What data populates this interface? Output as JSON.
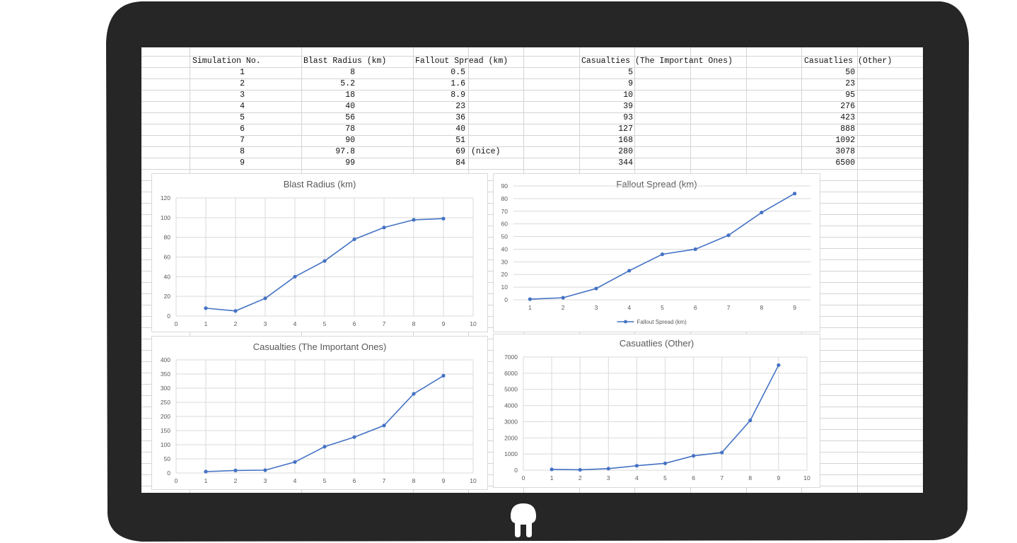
{
  "sheet": {
    "headers": [
      "Simulation No.",
      "Blast Radius (km)",
      "Fallout Spread (km)",
      "Casualties (The Important Ones)",
      "Casuatlies (Other)"
    ],
    "rows": [
      [
        "1",
        "8",
        "0.5",
        "",
        "5",
        "50"
      ],
      [
        "2",
        "5.2",
        "1.6",
        "",
        "9",
        "23"
      ],
      [
        "3",
        "18",
        "8.9",
        "",
        "10",
        "95"
      ],
      [
        "4",
        "40",
        "23",
        "",
        "39",
        "276"
      ],
      [
        "5",
        "56",
        "36",
        "",
        "93",
        "423"
      ],
      [
        "6",
        "78",
        "40",
        "",
        "127",
        "888"
      ],
      [
        "7",
        "90",
        "51",
        "",
        "168",
        "1092"
      ],
      [
        "8",
        "97.8",
        "69",
        "(nice)",
        "280",
        "3078"
      ],
      [
        "9",
        "99",
        "84",
        "",
        "344",
        "6500"
      ]
    ]
  },
  "colors": {
    "series": "#4472c4",
    "gridline": "#d9d9d9",
    "tablet": "#262626"
  },
  "chart_data": [
    {
      "type": "scatter",
      "title": "Blast Radius (km)",
      "x": [
        1,
        2,
        3,
        4,
        5,
        6,
        7,
        8,
        9
      ],
      "series": [
        {
          "values": [
            8,
            5.2,
            18,
            40,
            56,
            78,
            90,
            97.8,
            99
          ]
        }
      ],
      "xlim": [
        0,
        10
      ],
      "ylim": [
        0,
        120
      ],
      "xticks": [
        "0",
        "1",
        "2",
        "3",
        "4",
        "5",
        "6",
        "7",
        "8",
        "9",
        "10"
      ],
      "yticks": [
        "0",
        "20",
        "40",
        "60",
        "80",
        "100",
        "120"
      ],
      "grid": true,
      "legend": "none"
    },
    {
      "type": "line",
      "title": "Fallout Spread (km)",
      "categories": [
        "1",
        "2",
        "3",
        "4",
        "5",
        "6",
        "7",
        "8",
        "9"
      ],
      "series": [
        {
          "name": "Fallout Spread (km)",
          "values": [
            0.5,
            1.6,
            8.9,
            23,
            36,
            40,
            51,
            69,
            84
          ]
        }
      ],
      "ylim": [
        0,
        90
      ],
      "yticks": [
        "0",
        "10",
        "20",
        "30",
        "40",
        "50",
        "60",
        "70",
        "80",
        "90"
      ],
      "grid": true,
      "legend": "bottom"
    },
    {
      "type": "scatter",
      "title": "Casualties (The Important Ones)",
      "x": [
        1,
        2,
        3,
        4,
        5,
        6,
        7,
        8,
        9
      ],
      "series": [
        {
          "values": [
            5,
            9,
            10,
            39,
            93,
            127,
            168,
            280,
            344
          ]
        }
      ],
      "xlim": [
        0,
        10
      ],
      "ylim": [
        0,
        400
      ],
      "xticks": [
        "0",
        "1",
        "2",
        "3",
        "4",
        "5",
        "6",
        "7",
        "8",
        "9",
        "10"
      ],
      "yticks": [
        "0",
        "50",
        "100",
        "150",
        "200",
        "250",
        "300",
        "350",
        "400"
      ],
      "grid": true,
      "legend": "none"
    },
    {
      "type": "scatter",
      "title": "Casuatlies (Other)",
      "x": [
        1,
        2,
        3,
        4,
        5,
        6,
        7,
        8,
        9
      ],
      "series": [
        {
          "values": [
            50,
            23,
            95,
            276,
            423,
            888,
            1092,
            3078,
            6500
          ]
        }
      ],
      "xlim": [
        0,
        10
      ],
      "ylim": [
        0,
        7000
      ],
      "xticks": [
        "0",
        "1",
        "2",
        "3",
        "4",
        "5",
        "6",
        "7",
        "8",
        "9",
        "10"
      ],
      "yticks": [
        "0",
        "1000",
        "2000",
        "3000",
        "4000",
        "5000",
        "6000",
        "7000"
      ],
      "grid": true,
      "legend": "none"
    }
  ]
}
